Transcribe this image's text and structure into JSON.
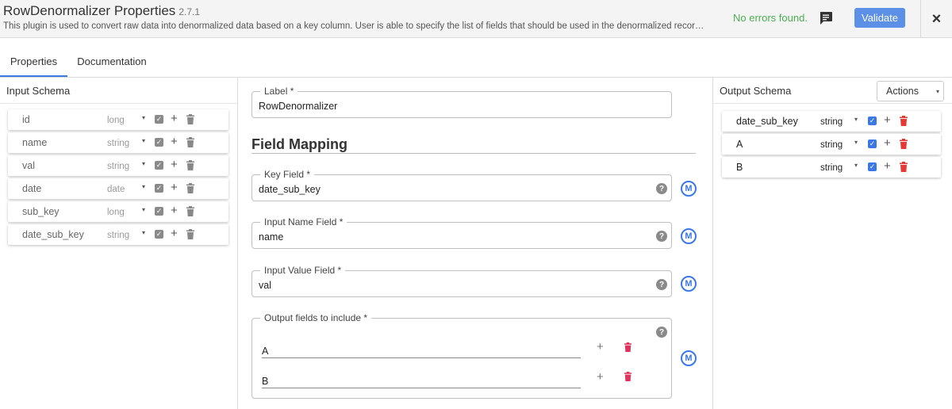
{
  "header": {
    "title": "RowDenormalizer Properties",
    "version": "2.7.1",
    "description": "This plugin is used to convert raw data into denormalized data based on a key column. User is able to specify the list of fields that should be used in the denormalized recor…",
    "status": "No errors found.",
    "validate_label": "Validate",
    "close_label": "×"
  },
  "tabs": [
    {
      "label": "Properties",
      "active": true
    },
    {
      "label": "Documentation",
      "active": false
    }
  ],
  "input_schema": {
    "title": "Input Schema",
    "fields": [
      {
        "name": "id",
        "type": "long"
      },
      {
        "name": "name",
        "type": "string"
      },
      {
        "name": "val",
        "type": "string"
      },
      {
        "name": "date",
        "type": "date"
      },
      {
        "name": "sub_key",
        "type": "long"
      },
      {
        "name": "date_sub_key",
        "type": "string"
      }
    ]
  },
  "output_schema": {
    "title": "Output Schema",
    "actions_label": "Actions",
    "fields": [
      {
        "name": "date_sub_key",
        "type": "string"
      },
      {
        "name": "A",
        "type": "string"
      },
      {
        "name": "B",
        "type": "string"
      }
    ]
  },
  "config": {
    "label": {
      "legend": "Label *",
      "value": "RowDenormalizer"
    },
    "section_title": "Field Mapping",
    "key_field": {
      "legend": "Key Field *",
      "value": "date_sub_key"
    },
    "input_name_field": {
      "legend": "Input Name Field *",
      "value": "name"
    },
    "input_value_field": {
      "legend": "Input Value Field *",
      "value": "val"
    },
    "output_fields": {
      "legend": "Output fields to include *",
      "values": [
        "A",
        "B"
      ]
    }
  },
  "icons": {
    "help": "?",
    "macro": "M",
    "plus": "+",
    "check": "✓",
    "caret": "▾"
  },
  "colors": {
    "accent": "#3b78e7",
    "validate": "#5c8fe6",
    "success": "#4caf50",
    "delete_red": "#e53935",
    "delete_pink": "#e0335c"
  }
}
